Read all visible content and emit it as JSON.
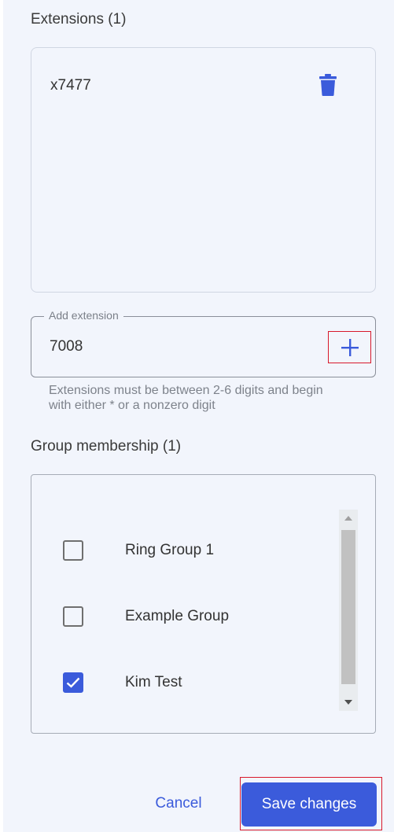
{
  "extensions": {
    "title": "Extensions (1)",
    "items": [
      {
        "label": "x7477",
        "delete_icon": "trash-icon"
      }
    ]
  },
  "add_extension": {
    "legend": "Add extension",
    "value": "7008",
    "add_icon": "plus-icon",
    "helper_text": "Extensions must be between 2-6 digits and begin with either * or a nonzero digit"
  },
  "group_membership": {
    "title": "Group membership (1)",
    "groups": [
      {
        "label": "Ring Group 1",
        "checked": false
      },
      {
        "label": "Example Group",
        "checked": false
      },
      {
        "label": "Kim Test",
        "checked": true
      }
    ]
  },
  "actions": {
    "cancel_label": "Cancel",
    "save_label": "Save changes"
  },
  "colors": {
    "accent": "#3b5bdb",
    "highlight_outline": "#d8192b",
    "panel_background": "#f2f5fc"
  }
}
